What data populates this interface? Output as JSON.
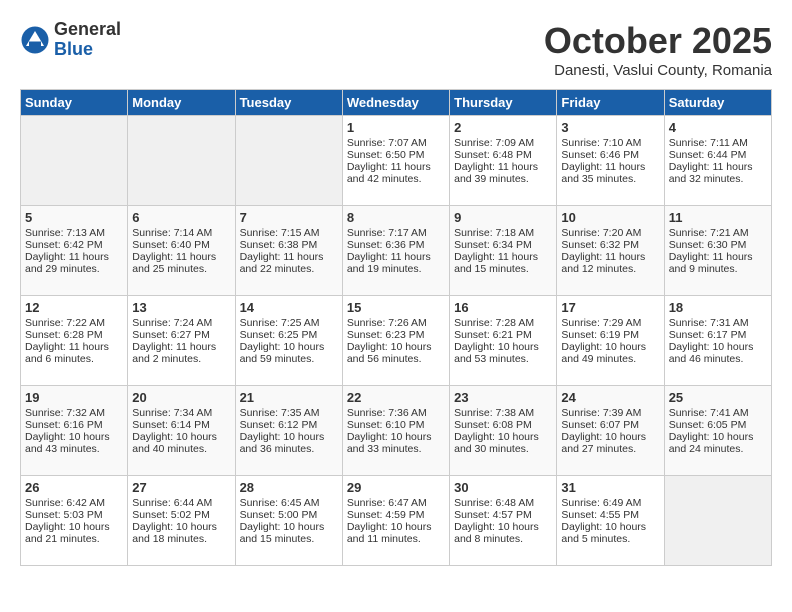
{
  "header": {
    "logo_general": "General",
    "logo_blue": "Blue",
    "title": "October 2025",
    "location": "Danesti, Vaslui County, Romania"
  },
  "days_of_week": [
    "Sunday",
    "Monday",
    "Tuesday",
    "Wednesday",
    "Thursday",
    "Friday",
    "Saturday"
  ],
  "weeks": [
    [
      {
        "day": "",
        "info": "",
        "empty": true
      },
      {
        "day": "",
        "info": "",
        "empty": true
      },
      {
        "day": "",
        "info": "",
        "empty": true
      },
      {
        "day": "1",
        "info": "Sunrise: 7:07 AM\nSunset: 6:50 PM\nDaylight: 11 hours\nand 42 minutes."
      },
      {
        "day": "2",
        "info": "Sunrise: 7:09 AM\nSunset: 6:48 PM\nDaylight: 11 hours\nand 39 minutes."
      },
      {
        "day": "3",
        "info": "Sunrise: 7:10 AM\nSunset: 6:46 PM\nDaylight: 11 hours\nand 35 minutes."
      },
      {
        "day": "4",
        "info": "Sunrise: 7:11 AM\nSunset: 6:44 PM\nDaylight: 11 hours\nand 32 minutes."
      }
    ],
    [
      {
        "day": "5",
        "info": "Sunrise: 7:13 AM\nSunset: 6:42 PM\nDaylight: 11 hours\nand 29 minutes."
      },
      {
        "day": "6",
        "info": "Sunrise: 7:14 AM\nSunset: 6:40 PM\nDaylight: 11 hours\nand 25 minutes."
      },
      {
        "day": "7",
        "info": "Sunrise: 7:15 AM\nSunset: 6:38 PM\nDaylight: 11 hours\nand 22 minutes."
      },
      {
        "day": "8",
        "info": "Sunrise: 7:17 AM\nSunset: 6:36 PM\nDaylight: 11 hours\nand 19 minutes."
      },
      {
        "day": "9",
        "info": "Sunrise: 7:18 AM\nSunset: 6:34 PM\nDaylight: 11 hours\nand 15 minutes."
      },
      {
        "day": "10",
        "info": "Sunrise: 7:20 AM\nSunset: 6:32 PM\nDaylight: 11 hours\nand 12 minutes."
      },
      {
        "day": "11",
        "info": "Sunrise: 7:21 AM\nSunset: 6:30 PM\nDaylight: 11 hours\nand 9 minutes."
      }
    ],
    [
      {
        "day": "12",
        "info": "Sunrise: 7:22 AM\nSunset: 6:28 PM\nDaylight: 11 hours\nand 6 minutes."
      },
      {
        "day": "13",
        "info": "Sunrise: 7:24 AM\nSunset: 6:27 PM\nDaylight: 11 hours\nand 2 minutes."
      },
      {
        "day": "14",
        "info": "Sunrise: 7:25 AM\nSunset: 6:25 PM\nDaylight: 10 hours\nand 59 minutes."
      },
      {
        "day": "15",
        "info": "Sunrise: 7:26 AM\nSunset: 6:23 PM\nDaylight: 10 hours\nand 56 minutes."
      },
      {
        "day": "16",
        "info": "Sunrise: 7:28 AM\nSunset: 6:21 PM\nDaylight: 10 hours\nand 53 minutes."
      },
      {
        "day": "17",
        "info": "Sunrise: 7:29 AM\nSunset: 6:19 PM\nDaylight: 10 hours\nand 49 minutes."
      },
      {
        "day": "18",
        "info": "Sunrise: 7:31 AM\nSunset: 6:17 PM\nDaylight: 10 hours\nand 46 minutes."
      }
    ],
    [
      {
        "day": "19",
        "info": "Sunrise: 7:32 AM\nSunset: 6:16 PM\nDaylight: 10 hours\nand 43 minutes."
      },
      {
        "day": "20",
        "info": "Sunrise: 7:34 AM\nSunset: 6:14 PM\nDaylight: 10 hours\nand 40 minutes."
      },
      {
        "day": "21",
        "info": "Sunrise: 7:35 AM\nSunset: 6:12 PM\nDaylight: 10 hours\nand 36 minutes."
      },
      {
        "day": "22",
        "info": "Sunrise: 7:36 AM\nSunset: 6:10 PM\nDaylight: 10 hours\nand 33 minutes."
      },
      {
        "day": "23",
        "info": "Sunrise: 7:38 AM\nSunset: 6:08 PM\nDaylight: 10 hours\nand 30 minutes."
      },
      {
        "day": "24",
        "info": "Sunrise: 7:39 AM\nSunset: 6:07 PM\nDaylight: 10 hours\nand 27 minutes."
      },
      {
        "day": "25",
        "info": "Sunrise: 7:41 AM\nSunset: 6:05 PM\nDaylight: 10 hours\nand 24 minutes."
      }
    ],
    [
      {
        "day": "26",
        "info": "Sunrise: 6:42 AM\nSunset: 5:03 PM\nDaylight: 10 hours\nand 21 minutes."
      },
      {
        "day": "27",
        "info": "Sunrise: 6:44 AM\nSunset: 5:02 PM\nDaylight: 10 hours\nand 18 minutes."
      },
      {
        "day": "28",
        "info": "Sunrise: 6:45 AM\nSunset: 5:00 PM\nDaylight: 10 hours\nand 15 minutes."
      },
      {
        "day": "29",
        "info": "Sunrise: 6:47 AM\nSunset: 4:59 PM\nDaylight: 10 hours\nand 11 minutes."
      },
      {
        "day": "30",
        "info": "Sunrise: 6:48 AM\nSunset: 4:57 PM\nDaylight: 10 hours\nand 8 minutes."
      },
      {
        "day": "31",
        "info": "Sunrise: 6:49 AM\nSunset: 4:55 PM\nDaylight: 10 hours\nand 5 minutes."
      },
      {
        "day": "",
        "info": "",
        "empty": true
      }
    ]
  ]
}
